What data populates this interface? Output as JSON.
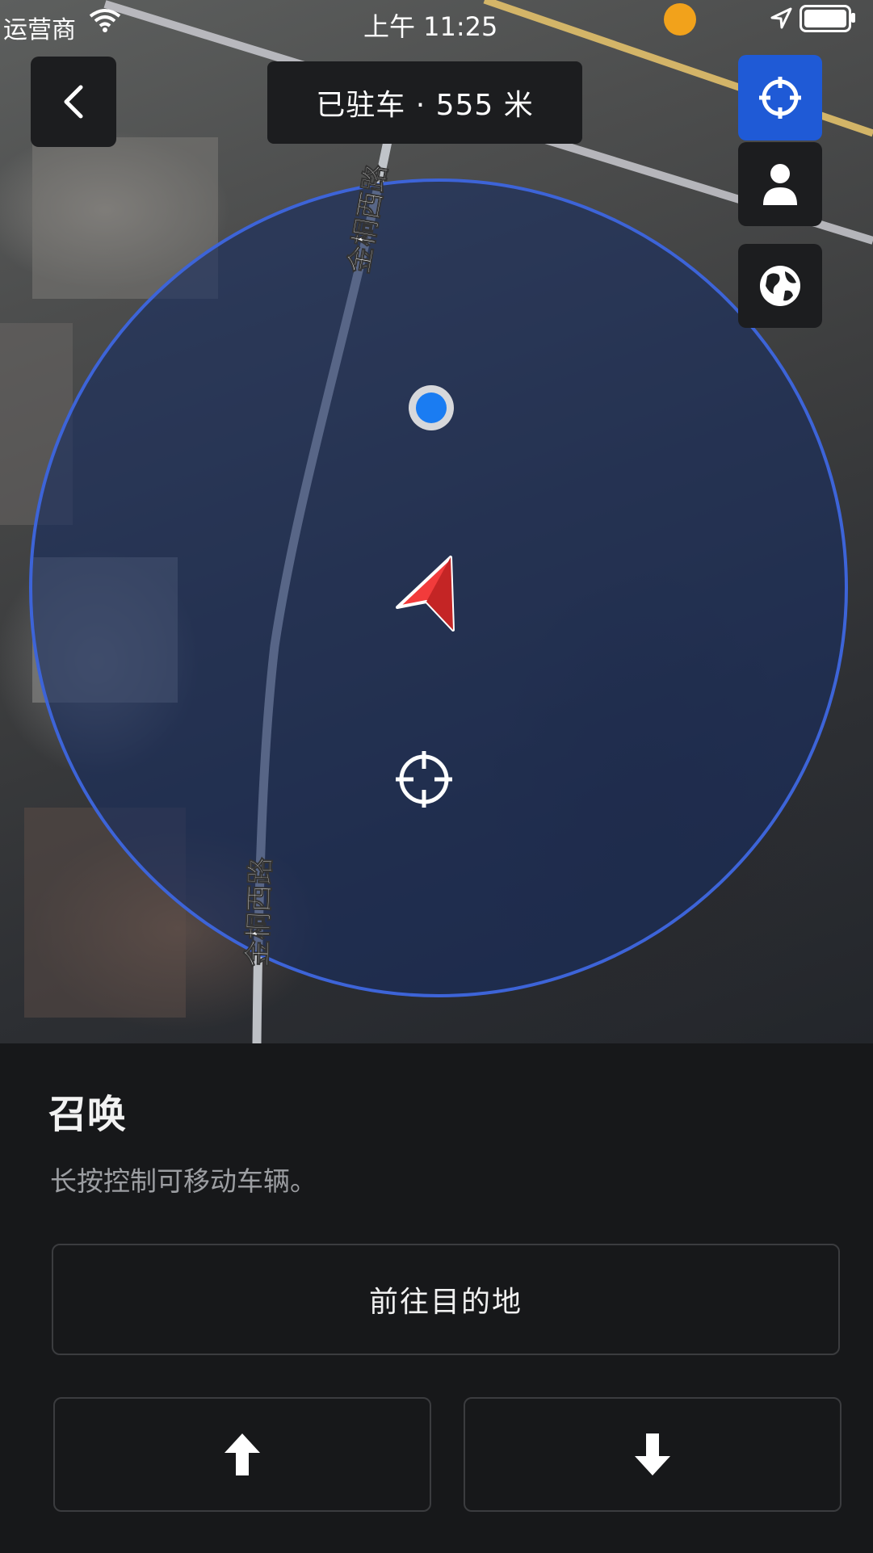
{
  "status_bar": {
    "carrier": "运营商",
    "time": "上午 11:25",
    "icons": [
      "wifi-icon",
      "work-badge-icon",
      "location-arrow-icon",
      "battery-icon"
    ]
  },
  "header": {
    "back_icon": "chevron-left-icon",
    "status_text": "已驻车 · 555 米"
  },
  "map": {
    "street_labels": [
      "金桐西路",
      "金桐西路"
    ],
    "markers": [
      "user-location-dot",
      "vehicle-arrow",
      "target-crosshair"
    ],
    "controls": [
      "recenter-icon",
      "person-icon",
      "globe-icon"
    ],
    "accent_color": "#1f5ad6",
    "circle_color": "#3d64d8",
    "vehicle_color": "#f23b3b"
  },
  "panel": {
    "title": "召唤",
    "description": "长按控制可移动车辆。",
    "destination_button": "前往目的地",
    "forward_icon": "arrow-up-icon",
    "reverse_icon": "arrow-down-icon"
  }
}
